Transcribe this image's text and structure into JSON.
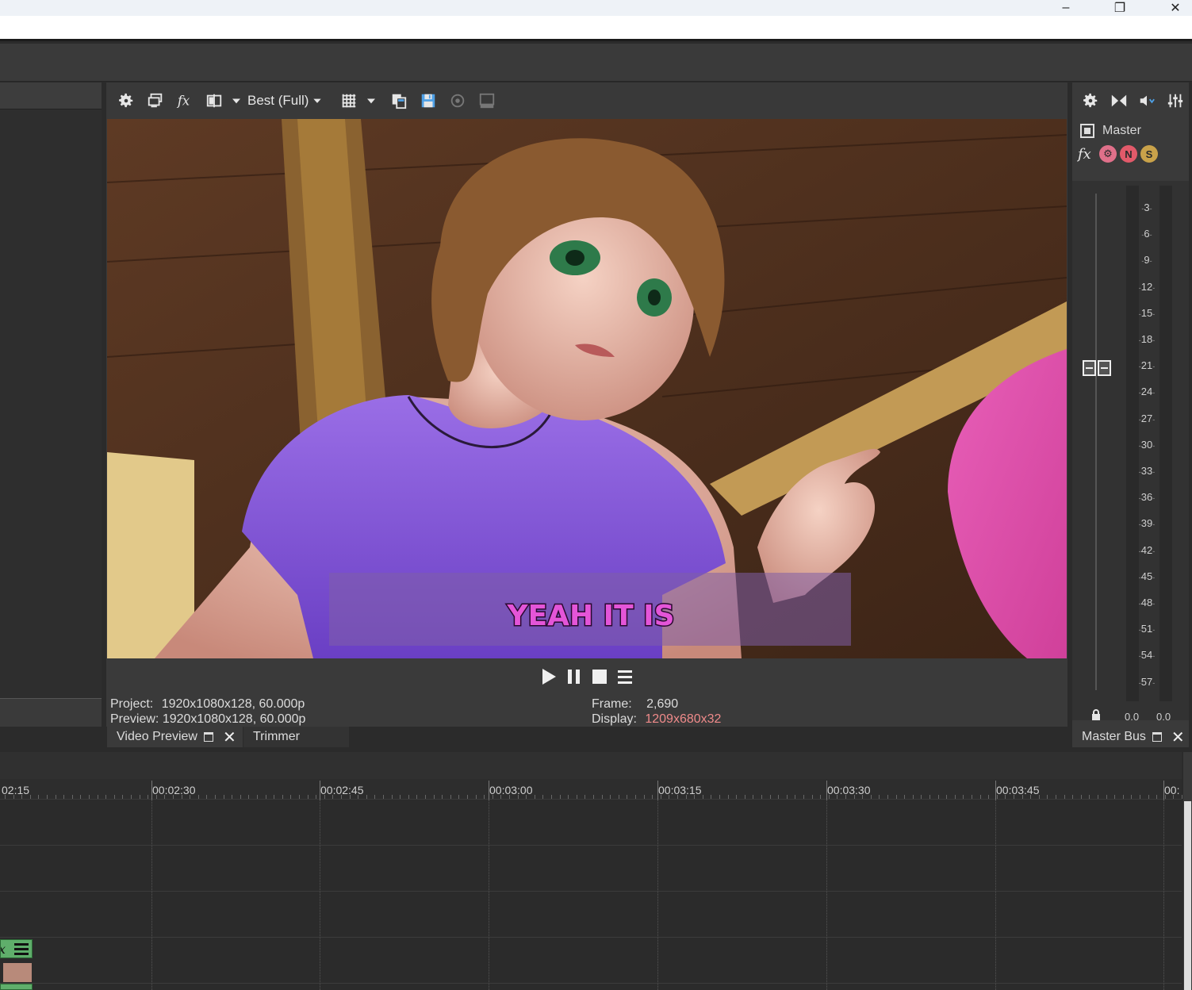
{
  "window": {
    "controls": [
      "minimize-icon",
      "restore-icon",
      "close-icon"
    ]
  },
  "preview": {
    "toolbar": {
      "quality_label": "Best (Full)",
      "icons": [
        "gear-icon",
        "external-monitor-icon",
        "fx-icon",
        "split-screen-icon",
        "dropdown-icon",
        "quality-dropdown-icon",
        "grid-overlay-icon",
        "grid-dropdown-icon",
        "copy-snapshot-icon",
        "save-snapshot-icon",
        "color-adjust-icon",
        "hdr-icon"
      ]
    },
    "subtitle": "YEAH IT IS",
    "info": {
      "project_label": "Project:",
      "project_value": "1920x1080x128, 60.000p",
      "preview_label": "Preview:",
      "preview_value": "1920x1080x128, 60.000p",
      "frame_label": "Frame:",
      "frame_value": "2,690",
      "display_label": "Display:",
      "display_value": "1209x680x32"
    },
    "transport": [
      "play-icon",
      "pause-icon",
      "stop-icon",
      "menu-icon"
    ]
  },
  "tabs": {
    "video_preview": "Video Preview",
    "trimmer": "Trimmer",
    "master_bus": "Master Bus"
  },
  "master": {
    "name": "Master",
    "scale": [
      "3",
      "6",
      "9",
      "12",
      "15",
      "18",
      "21",
      "24",
      "27",
      "30",
      "33",
      "36",
      "39",
      "42",
      "45",
      "48",
      "51",
      "54",
      "57"
    ],
    "level_left": "0.0",
    "level_right": "0.0",
    "toolbar_icons": [
      "gear-icon",
      "bypass-icon",
      "mute-icon",
      "mixer-icon"
    ]
  },
  "timeline": {
    "ruler": [
      "02:15",
      "00:02:30",
      "00:02:45",
      "00:03:00",
      "00:03:15",
      "00:03:30",
      "00:03:45",
      "00:"
    ]
  },
  "colors": {
    "subtitle_fill": "#e455d8",
    "display_value": "#ef8a8a",
    "clip_header": "#5fae6b"
  }
}
